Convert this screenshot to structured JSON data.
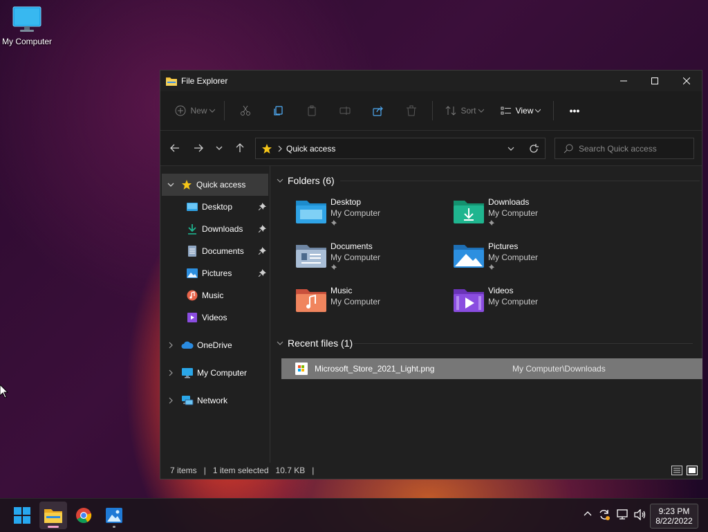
{
  "desktop": {
    "icons": [
      {
        "label": "My Computer",
        "icon": "monitor-icon"
      }
    ]
  },
  "window": {
    "title": "File Explorer",
    "toolbar": {
      "new_label": "New",
      "sort_label": "Sort",
      "view_label": "View",
      "more_label": "•••"
    },
    "address": {
      "breadcrumb": "Quick access",
      "search_placeholder": "Search Quick access"
    },
    "sidebar": {
      "items": [
        {
          "label": "Quick access",
          "icon": "star-icon",
          "pinned": false
        },
        {
          "label": "Desktop",
          "icon": "desktop-folder-icon",
          "pinned": true
        },
        {
          "label": "Downloads",
          "icon": "download-icon",
          "pinned": true
        },
        {
          "label": "Documents",
          "icon": "document-icon",
          "pinned": true
        },
        {
          "label": "Pictures",
          "icon": "pictures-icon",
          "pinned": true
        },
        {
          "label": "Music",
          "icon": "music-icon",
          "pinned": false
        },
        {
          "label": "Videos",
          "icon": "videos-icon",
          "pinned": false
        },
        {
          "label": "OneDrive",
          "icon": "cloud-icon",
          "pinned": false
        },
        {
          "label": "My Computer",
          "icon": "monitor-icon",
          "pinned": false
        },
        {
          "label": "Network",
          "icon": "network-icon",
          "pinned": false
        }
      ]
    },
    "content": {
      "folders_header": "Folders (6)",
      "folders": [
        {
          "name": "Desktop",
          "location": "My Computer",
          "pinned": true,
          "icon": "desktop-folder-icon",
          "color": "#2fa3e6"
        },
        {
          "name": "Downloads",
          "location": "My Computer",
          "pinned": true,
          "icon": "downloads-folder-icon",
          "color": "#1fb58f"
        },
        {
          "name": "Documents",
          "location": "My Computer",
          "pinned": true,
          "icon": "documents-folder-icon",
          "color": "#8fa6c2"
        },
        {
          "name": "Pictures",
          "location": "My Computer",
          "pinned": true,
          "icon": "pictures-folder-icon",
          "color": "#2c8fe0"
        },
        {
          "name": "Music",
          "location": "My Computer",
          "pinned": false,
          "icon": "music-folder-icon",
          "color": "#e8644a"
        },
        {
          "name": "Videos",
          "location": "My Computer",
          "pinned": false,
          "icon": "videos-folder-icon",
          "color": "#8a4de0"
        }
      ],
      "recent_header": "Recent files (1)",
      "recent": [
        {
          "name": "Microsoft_Store_2021_Light.png",
          "location": "My Computer\\Downloads",
          "icon": "image-file-icon"
        }
      ]
    },
    "status": {
      "count": "7 items",
      "selection": "1 item selected",
      "size": "10.7 KB"
    }
  },
  "taskbar": {
    "apps": [
      {
        "name": "start",
        "icon": "windows-start-icon"
      },
      {
        "name": "file-explorer",
        "icon": "folder-icon",
        "active": true
      },
      {
        "name": "chrome",
        "icon": "chrome-icon"
      },
      {
        "name": "photos",
        "icon": "photos-icon"
      }
    ],
    "clock": {
      "time": "9:23 PM",
      "date": "8/22/2022"
    }
  }
}
